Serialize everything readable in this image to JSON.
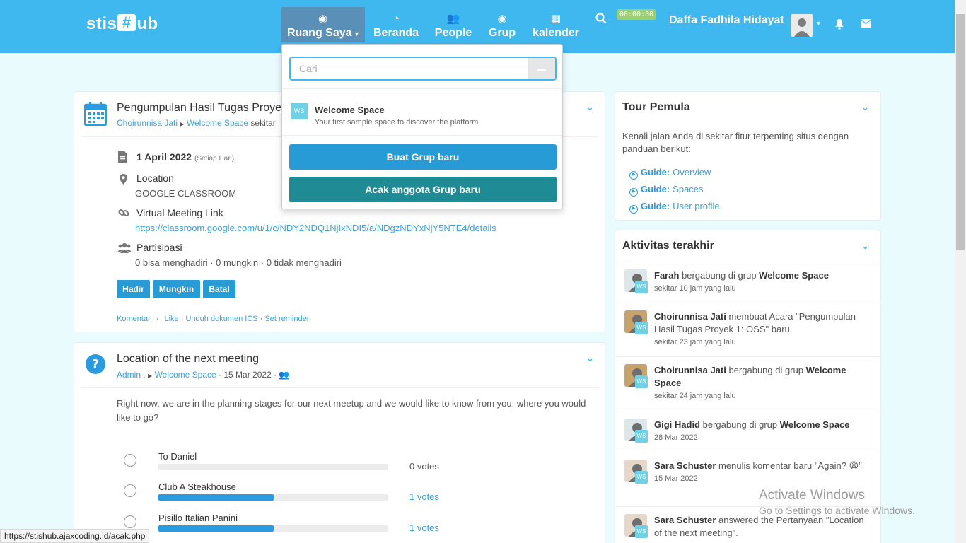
{
  "nav": {
    "logo": "stisHub",
    "items": [
      {
        "label": "Ruang Saya",
        "icon": "circle-dot-icon"
      },
      {
        "label": "Beranda",
        "icon": "dashboard-icon"
      },
      {
        "label": "People",
        "icon": "users-icon"
      },
      {
        "label": "Grup",
        "icon": "circle-dot-icon"
      },
      {
        "label": "kalender",
        "icon": "calendar-icon"
      }
    ],
    "timer": "00:00:00",
    "user_name": "Daffa Fadhila Hidayat"
  },
  "dropdown": {
    "search_placeholder": "Cari",
    "space_badge": "WS",
    "space_name": "Welcome Space",
    "space_desc": "Your first sample space to discover the platform.",
    "create_button": "Buat Grup baru",
    "random_button": "Acak anggota Grup baru"
  },
  "event": {
    "title": "Pengumpulan Hasil Tugas Proyek",
    "author": "Choirunnisa Jati",
    "space": "Welcome Space",
    "time_prefix": "sekitar",
    "date": "1 April 2022",
    "date_note": "(Setiap Hari)",
    "location_label": "Location",
    "location_value": "GOOGLE CLASSROOM",
    "meeting_label": "Virtual Meeting Link",
    "meeting_url": "https://classroom.google.com/u/1/c/NDY2NDQ1NjIxNDI5/a/NDgzNDYxNjY5NTE4/details",
    "participation_label": "Partisipasi",
    "participation_value": "0 bisa menghadiri · 0 mungkin · 0 tidak menghadiri",
    "btn_attend": "Hadir",
    "btn_maybe": "Mungkin",
    "btn_decline": "Batal",
    "action_comment": "Komentar",
    "action_like": "Like",
    "action_ics": "Unduh dokumen ICS",
    "action_reminder": "Set reminder",
    "sep_dot": "·",
    "sep_dot_spaced": " · "
  },
  "poll": {
    "title": "Location of the next meeting",
    "author": "Admin .",
    "space": "Welcome Space",
    "date": "· 15 Mar 2022 ·",
    "question": "Right now, we are in the planning stages for our next meetup and we would like to know from you, where you would like to go?",
    "options": [
      {
        "label": "To Daniel",
        "votes": "0 votes",
        "fraction": 0
      },
      {
        "label": "Club A Steakhouse",
        "votes": "1 votes",
        "fraction": 0.5
      },
      {
        "label": "Pisillo Italian Panini",
        "votes": "1 votes",
        "fraction": 0.5
      }
    ]
  },
  "tour": {
    "title": "Tour Pemula",
    "intro": "Kenali jalan Anda di sekitar fitur terpenting situs dengan panduan berikut:",
    "guides": [
      {
        "prefix": "Guide:",
        "label": "Overview"
      },
      {
        "prefix": "Guide:",
        "label": "Spaces"
      },
      {
        "prefix": "Guide:",
        "label": "User profile"
      }
    ]
  },
  "activity": {
    "title": "Aktivitas terakhir",
    "items": [
      {
        "actor": "Farah",
        "text": " bergabung di grup ",
        "target": "Welcome Space",
        "time": "sekitar 10 jam yang lalu"
      },
      {
        "actor": "Choirunnisa Jati",
        "text": " membuat Acara \"Pengumpulan Hasil Tugas Proyek 1: OSS\" baru.",
        "target": "",
        "time": "sekitar 23 jam yang lalu"
      },
      {
        "actor": "Choirunnisa Jati",
        "text": " bergabung di grup ",
        "target": "Welcome Space",
        "time": "sekitar 24 jam yang lalu"
      },
      {
        "actor": "Gigi Hadid",
        "text": " bergabung di grup ",
        "target": "Welcome Space",
        "time": "28 Mar 2022"
      },
      {
        "actor": "Sara Schuster",
        "text": " menulis komentar baru \"Again? 😩\"",
        "target": "",
        "time": "15 Mar 2022"
      },
      {
        "actor": "Sara Schuster",
        "text": " answered the Pertanyaan \"Location of the next meeting\".",
        "target": "",
        "time": ""
      }
    ],
    "ws_badge": "WS"
  },
  "status_url": "https://stishub.ajaxcoding.id/acak.php",
  "watermark": {
    "line1": "Activate Windows",
    "line2": "Go to Settings to activate Windows."
  },
  "colors": {
    "nav": "#3fb8f0",
    "accent": "#279bd6",
    "teal": "#1f8c95",
    "bg": "#e9fbfd"
  }
}
